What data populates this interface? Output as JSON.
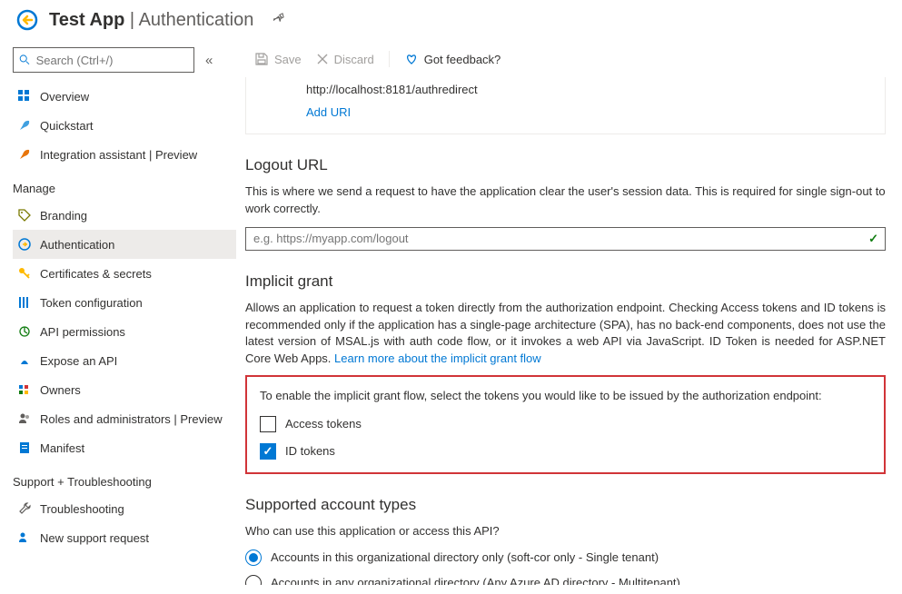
{
  "header": {
    "app_name": "Test App",
    "page_name": "Authentication"
  },
  "sidebar": {
    "search_placeholder": "Search (Ctrl+/)",
    "items_top": [
      {
        "label": "Overview",
        "icon": "grid"
      },
      {
        "label": "Quickstart",
        "icon": "rocket-blue"
      },
      {
        "label": "Integration assistant | Preview",
        "icon": "rocket-orange"
      }
    ],
    "section_manage": "Manage",
    "items_manage": [
      {
        "label": "Branding",
        "icon": "tag"
      },
      {
        "label": "Authentication",
        "icon": "auth",
        "selected": true
      },
      {
        "label": "Certificates & secrets",
        "icon": "key"
      },
      {
        "label": "Token configuration",
        "icon": "tokens"
      },
      {
        "label": "API permissions",
        "icon": "api-perm"
      },
      {
        "label": "Expose an API",
        "icon": "expose"
      },
      {
        "label": "Owners",
        "icon": "owners"
      },
      {
        "label": "Roles and administrators | Preview",
        "icon": "roles"
      },
      {
        "label": "Manifest",
        "icon": "manifest"
      }
    ],
    "section_support": "Support + Troubleshooting",
    "items_support": [
      {
        "label": "Troubleshooting",
        "icon": "wrench"
      },
      {
        "label": "New support request",
        "icon": "support"
      }
    ]
  },
  "toolbar": {
    "save": "Save",
    "discard": "Discard",
    "feedback": "Got feedback?"
  },
  "redirect": {
    "uri": "http://localhost:8181/authredirect",
    "add_uri": "Add URI"
  },
  "logout": {
    "title": "Logout URL",
    "text": "This is where we send a request to have the application clear the user's session data. This is required for single sign-out to work correctly.",
    "placeholder": "e.g. https://myapp.com/logout"
  },
  "implicit": {
    "title": "Implicit grant",
    "text": "Allows an application to request a token directly from the authorization endpoint. Checking Access tokens and ID tokens is recommended only if the application has a single-page architecture (SPA), has no back-end components, does not use the latest version of MSAL.js with auth code flow, or it invokes a web API via JavaScript. ID Token is needed for ASP.NET Core Web Apps. ",
    "link": "Learn more about the implicit grant flow",
    "box_text": "To enable the implicit grant flow, select the tokens you would like to be issued by the authorization endpoint:",
    "opt_access": "Access tokens",
    "opt_id": "ID tokens"
  },
  "account_types": {
    "title": "Supported account types",
    "text": "Who can use this application or access this API?",
    "opt1": "Accounts in this organizational directory only (soft-cor only - Single tenant)",
    "opt2": "Accounts in any organizational directory (Any Azure AD directory - Multitenant)"
  }
}
